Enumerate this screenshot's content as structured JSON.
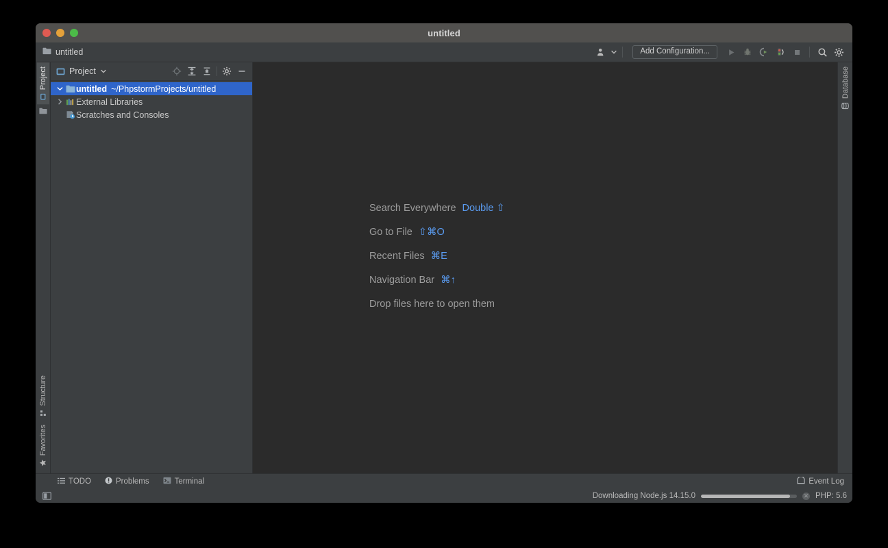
{
  "window": {
    "title": "untitled",
    "traffic_lights": [
      "close-red",
      "minimize-yellow",
      "maximize-green"
    ]
  },
  "toolbar": {
    "breadcrumb_label": "untitled",
    "breadcrumb_icon": "folder-icon",
    "avatar_icon": "user-account-icon",
    "avatar_dropdown_icon": "chevron-down-icon",
    "add_configuration_label": "Add Configuration...",
    "run_icon": "run-play-icon",
    "debug_icon": "debug-bug-icon",
    "run_coverage_icon": "run-with-coverage-icon",
    "profile_icon": "profile-traffic-icon",
    "stop_icon": "stop-square-icon",
    "search_icon": "search-icon",
    "settings_icon": "gear-icon"
  },
  "left_rail": {
    "top_tabs": [
      {
        "label": "Project",
        "icon": "project-window-icon",
        "active": true
      }
    ],
    "top_icons": [
      {
        "name": "folder-icon"
      }
    ],
    "bottom_tabs": [
      {
        "label": "Structure",
        "icon": "structure-icon",
        "active": false
      },
      {
        "label": "Favorites",
        "icon": "star-icon",
        "active": false
      }
    ]
  },
  "right_rail": {
    "tabs": [
      {
        "label": "Database",
        "icon": "database-icon",
        "active": false
      }
    ]
  },
  "project_panel": {
    "title": "Project",
    "title_icon": "project-window-icon",
    "dropdown_icon": "chevron-down-icon",
    "header_icons": [
      {
        "name": "locate-target-icon"
      },
      {
        "name": "expand-all-icon"
      },
      {
        "name": "collapse-all-icon"
      },
      {
        "name": "gear-icon"
      },
      {
        "name": "hide-minimize-icon"
      }
    ],
    "tree": [
      {
        "label": "untitled",
        "sublabel": "~/PhpstormProjects/untitled",
        "icon": "project-folder-icon",
        "twisty": "expanded",
        "selected": true,
        "indent": 0
      },
      {
        "label": "External Libraries",
        "sublabel": "",
        "icon": "external-libraries-icon",
        "twisty": "collapsed",
        "selected": false,
        "indent": 0
      },
      {
        "label": "Scratches and Consoles",
        "sublabel": "",
        "icon": "scratches-consoles-icon",
        "twisty": "none",
        "selected": false,
        "indent": 0
      }
    ]
  },
  "editor": {
    "hints": [
      {
        "label": "Search Everywhere",
        "shortcut": "Double ⇧"
      },
      {
        "label": "Go to File",
        "shortcut": "⇧⌘O"
      },
      {
        "label": "Recent Files",
        "shortcut": "⌘E"
      },
      {
        "label": "Navigation Bar",
        "shortcut": "⌘↑"
      },
      {
        "label": "Drop files here to open them",
        "shortcut": ""
      }
    ]
  },
  "bottom_bar": {
    "buttons": [
      {
        "label": "TODO",
        "icon": "todo-list-icon"
      },
      {
        "label": "Problems",
        "icon": "problems-warning-icon"
      },
      {
        "label": "Terminal",
        "icon": "terminal-icon"
      }
    ],
    "event_log_label": "Event Log",
    "event_log_icon": "event-log-balloon-icon"
  },
  "status_bar": {
    "left_icon": "toggle-tool-windows-icon",
    "progress_label": "Downloading Node.js 14.15.0",
    "progress_percent": 93,
    "cancel_icon": "cancel-x-icon",
    "php_version_label": "PHP: 5.6"
  },
  "colors": {
    "window_chrome": "#3c3f41",
    "titlebar": "#51504e",
    "editor_bg": "#2b2b2b",
    "selection_blue": "#2f65ca",
    "accent_link": "#5a9bf0",
    "text_primary": "#c7c7c7",
    "text_muted": "#9d9d9d"
  }
}
